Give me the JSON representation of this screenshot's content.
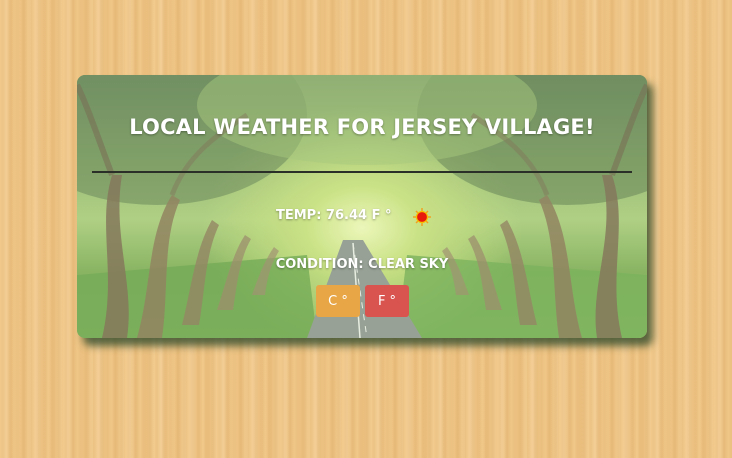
{
  "weather": {
    "title": "LOCAL WEATHER FOR JERSEY VILLAGE!",
    "temp_label": "TEMP: 76.44 F °",
    "condition_label": "CONDITION: CLEAR SKY",
    "icon": "sun-icon"
  },
  "units": {
    "celsius_label": "C °",
    "fahrenheit_label": "F °"
  },
  "colors": {
    "celsius_button": "#e8a646",
    "fahrenheit_button": "#d9534f",
    "wood_background": "#f2c98a"
  }
}
